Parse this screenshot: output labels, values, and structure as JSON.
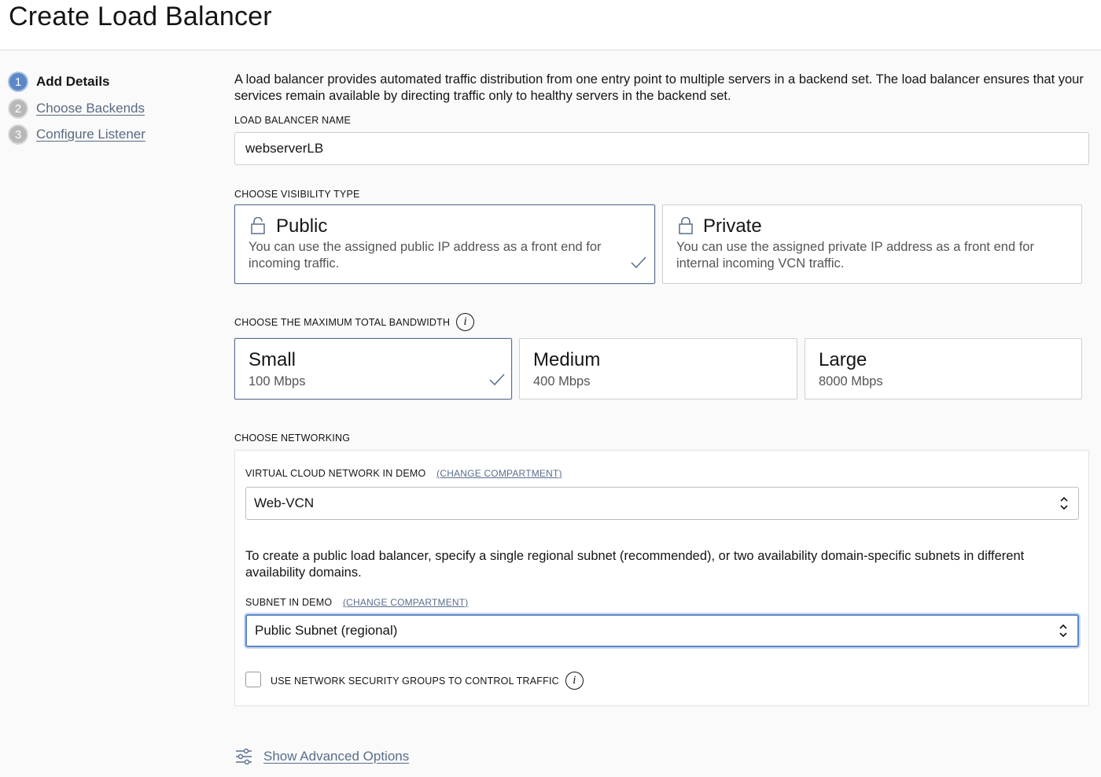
{
  "page": {
    "title": "Create Load Balancer"
  },
  "steps": [
    {
      "number": "1",
      "label": "Add Details",
      "state": "active"
    },
    {
      "number": "2",
      "label": "Choose Backends",
      "state": "link"
    },
    {
      "number": "3",
      "label": "Configure Listener",
      "state": "link"
    }
  ],
  "intro": "A load balancer provides automated traffic distribution from one entry point to multiple servers in a backend set. The load balancer ensures that your services remain available by directing traffic only to healthy servers in the backend set.",
  "name_field": {
    "label": "LOAD BALANCER NAME",
    "value": "webserverLB"
  },
  "visibility": {
    "label": "CHOOSE VISIBILITY TYPE",
    "options": [
      {
        "title": "Public",
        "desc": "You can use the assigned public IP address as a front end for incoming traffic.",
        "selected": true,
        "icon": "unlock-icon"
      },
      {
        "title": "Private",
        "desc": "You can use the assigned private IP address as a front end for internal incoming VCN traffic.",
        "selected": false,
        "icon": "lock-icon"
      }
    ]
  },
  "bandwidth": {
    "label": "CHOOSE THE MAXIMUM TOTAL BANDWIDTH",
    "options": [
      {
        "title": "Small",
        "desc": "100 Mbps",
        "selected": true
      },
      {
        "title": "Medium",
        "desc": "400 Mbps",
        "selected": false
      },
      {
        "title": "Large",
        "desc": "8000 Mbps",
        "selected": false
      }
    ]
  },
  "networking": {
    "label": "CHOOSE NETWORKING",
    "vcn_label": "VIRTUAL CLOUD NETWORK IN",
    "vcn_compartment": "DEMO",
    "vcn_change_link": "(CHANGE COMPARTMENT)",
    "vcn_value": "Web-VCN",
    "info_text": "To create a public load balancer, specify a single regional subnet (recommended), or two availability domain-specific subnets in different availability domains.",
    "subnet_label": "SUBNET IN",
    "subnet_compartment": "DEMO",
    "subnet_change_link": "(CHANGE COMPARTMENT)",
    "subnet_value": "Public Subnet (regional)",
    "nsg_label": "USE NETWORK SECURITY GROUPS TO CONTROL TRAFFIC",
    "nsg_checked": false
  },
  "advanced": {
    "label": "Show Advanced Options"
  },
  "colors": {
    "accent": "#5b87c7",
    "link": "#5a6e8c",
    "selected_border": "#5a6e8c"
  }
}
